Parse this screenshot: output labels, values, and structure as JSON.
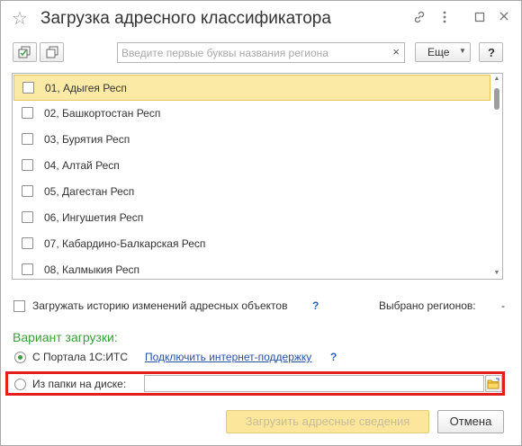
{
  "window": {
    "title": "Загрузка адресного классификатора"
  },
  "toolbar": {
    "search_placeholder": "Введите первые буквы названия региона",
    "search_value": "",
    "clear_glyph": "×",
    "more_label": "Еще",
    "help_label": "?"
  },
  "regions": [
    {
      "label": "01, Адыгея Респ",
      "checked": false,
      "selected": true
    },
    {
      "label": "02, Башкортостан Респ",
      "checked": false
    },
    {
      "label": "03, Бурятия Респ",
      "checked": false
    },
    {
      "label": "04, Алтай Респ",
      "checked": false
    },
    {
      "label": "05, Дагестан Респ",
      "checked": false
    },
    {
      "label": "06, Ингушетия Респ",
      "checked": false
    },
    {
      "label": "07, Кабардино-Балкарская Респ",
      "checked": false
    },
    {
      "label": "08, Калмыкия Респ",
      "checked": false
    }
  ],
  "options": {
    "history_label": "Загружать историю изменений адресных объектов",
    "help_mark": "?",
    "selected_label": "Выбрано регионов:",
    "selected_value": "-"
  },
  "variant": {
    "heading": "Вариант загрузки:",
    "portal_label": "С Портала 1С:ИТС",
    "portal_link": "Подключить интернет-поддержку",
    "folder_label": "Из папки на диске:",
    "folder_path": ""
  },
  "footer": {
    "load_label": "Загрузить адресные сведения",
    "cancel_label": "Отмена"
  },
  "colors": {
    "selection": "#fbe9a6",
    "accent_green": "#3b9e3b",
    "highlight_frame": "#e31e1e",
    "link": "#2451a3"
  }
}
